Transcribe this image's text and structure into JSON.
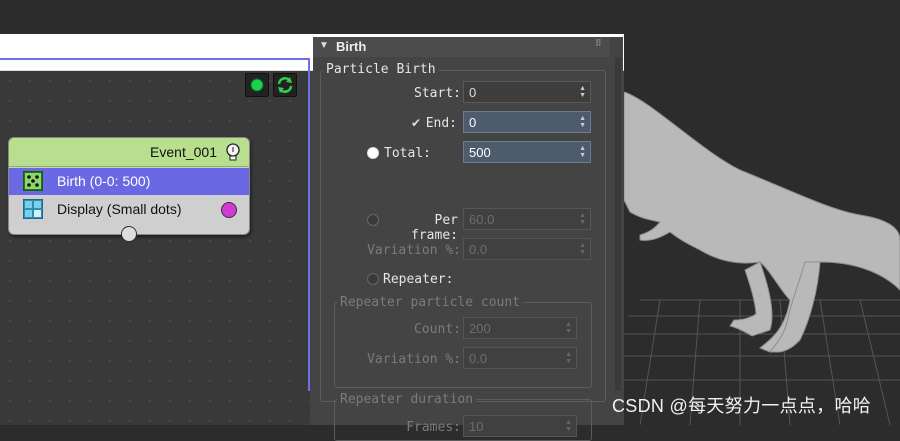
{
  "window": {
    "controls": {
      "minimize": "—",
      "maximize": "☐",
      "close": "✕"
    }
  },
  "graph": {
    "node": {
      "title": "Event_001",
      "operators": [
        {
          "label": "Birth (0-0: 500)",
          "icon": "birth-operator-icon",
          "selected": true
        },
        {
          "label": "Display (Small dots)",
          "icon": "display-operator-icon",
          "selected": false
        }
      ],
      "display_color": "#d23ad6"
    },
    "buttons": [
      {
        "name": "enable-toggle",
        "icon": "green-dot-icon"
      },
      {
        "name": "refresh",
        "icon": "refresh-icon"
      }
    ]
  },
  "params": {
    "rollout_title": "Birth",
    "group_title": "Particle Birth",
    "start_label": "Start:",
    "start_value": "0",
    "end_label": "End:",
    "end_value": "0",
    "end_checked": true,
    "total_label": "Total:",
    "total_value": "500",
    "total_selected": true,
    "per_frame_label": "Per frame:",
    "per_frame_value": "60.0",
    "variation_label": "Variation %:",
    "variation_value": "0.0",
    "repeater_label": "Repeater:",
    "repeater_count_group": "Repeater particle count",
    "count_label": "Count:",
    "count_value": "200",
    "variation2_label": "Variation %:",
    "variation2_value": "0.0",
    "repeater_duration_group": "Repeater duration",
    "frames_label": "Frames:",
    "frames_value": "10"
  },
  "watermark": "CSDN @每天努力一点点，哈哈",
  "colors": {
    "accent": "#6f6fe6",
    "event_header": "#b7df8e",
    "selected_row": "#6a68e2"
  }
}
